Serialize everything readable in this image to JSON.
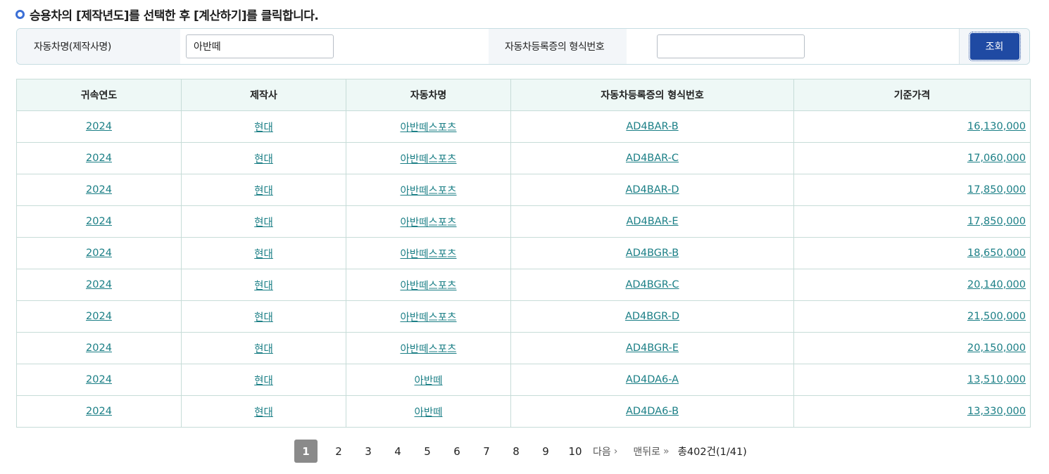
{
  "heading": "승용차의 [제작년도]를 선택한 후 [계산하기]를 클릭합니다.",
  "search": {
    "label1": "자동차명(제작사명)",
    "value1": "아반떼",
    "label2": "자동차등록증의 형식번호",
    "value2": "",
    "button": "조회"
  },
  "table": {
    "headers": [
      "귀속연도",
      "제작사",
      "자동차명",
      "자동차등록증의 형식번호",
      "기준가격"
    ],
    "rows": [
      [
        "2024",
        "현대",
        "아반떼스포츠",
        "AD4BAR-B",
        "16,130,000"
      ],
      [
        "2024",
        "현대",
        "아반떼스포츠",
        "AD4BAR-C",
        "17,060,000"
      ],
      [
        "2024",
        "현대",
        "아반떼스포츠",
        "AD4BAR-D",
        "17,850,000"
      ],
      [
        "2024",
        "현대",
        "아반떼스포츠",
        "AD4BAR-E",
        "17,850,000"
      ],
      [
        "2024",
        "현대",
        "아반떼스포츠",
        "AD4BGR-B",
        "18,650,000"
      ],
      [
        "2024",
        "현대",
        "아반떼스포츠",
        "AD4BGR-C",
        "20,140,000"
      ],
      [
        "2024",
        "현대",
        "아반떼스포츠",
        "AD4BGR-D",
        "21,500,000"
      ],
      [
        "2024",
        "현대",
        "아반떼스포츠",
        "AD4BGR-E",
        "20,150,000"
      ],
      [
        "2024",
        "현대",
        "아반떼",
        "AD4DA6-A",
        "13,510,000"
      ],
      [
        "2024",
        "현대",
        "아반떼",
        "AD4DA6-B",
        "13,330,000"
      ]
    ]
  },
  "pagination": {
    "pages": [
      "1",
      "2",
      "3",
      "4",
      "5",
      "6",
      "7",
      "8",
      "9",
      "10"
    ],
    "current": "1",
    "next": "다음",
    "last": "맨뒤로",
    "total": "총402건(1/41)"
  }
}
